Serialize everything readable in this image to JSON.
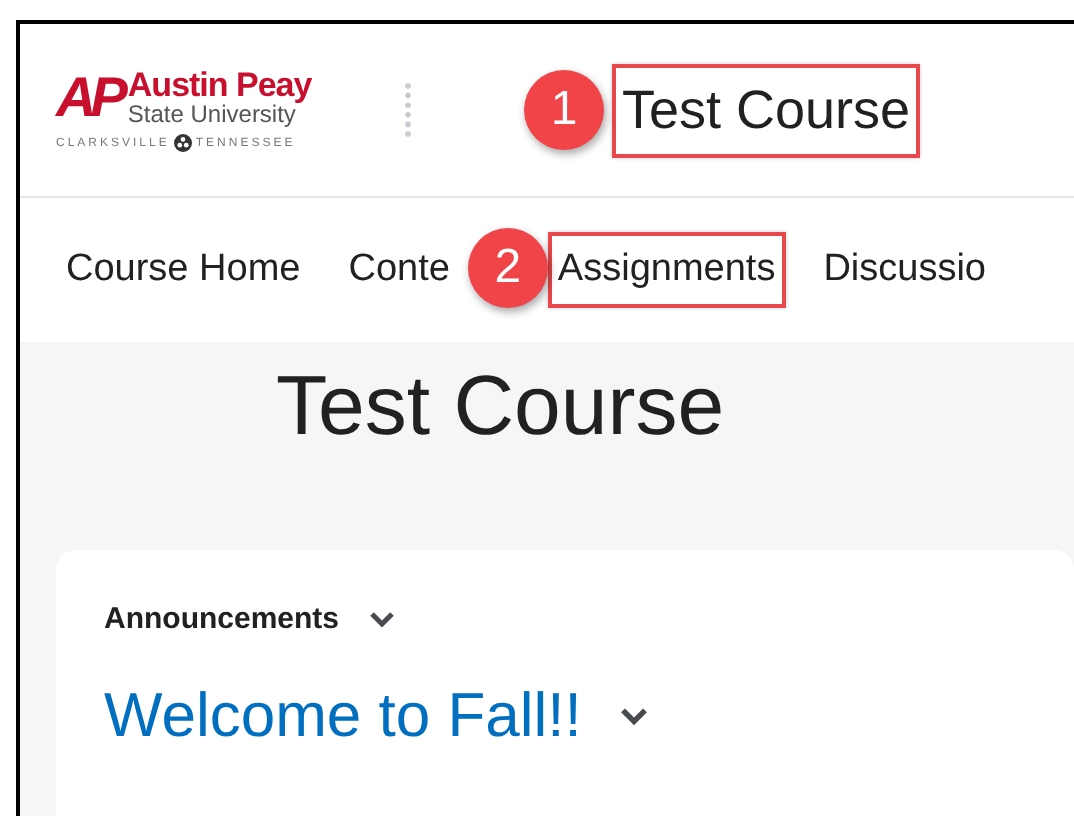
{
  "header": {
    "logo": {
      "mark": "AP",
      "name": "Austin Peay",
      "subtitle": "State University",
      "city": "CLARKSVILLE",
      "state": "TENNESSEE"
    },
    "course_title": {
      "text": "Test Course",
      "highlighted": true,
      "callout": "1"
    }
  },
  "nav": [
    {
      "label": "Course Home",
      "highlighted": false
    },
    {
      "label": "Conte",
      "highlighted": false
    },
    {
      "label": "Assignments",
      "highlighted": true,
      "callout": "2"
    },
    {
      "label": "Discussio",
      "highlighted": false
    }
  ],
  "page_title": "Test Course",
  "widget": {
    "title": "Announcements",
    "items": [
      {
        "title": "Welcome to Fall!!"
      }
    ]
  }
}
